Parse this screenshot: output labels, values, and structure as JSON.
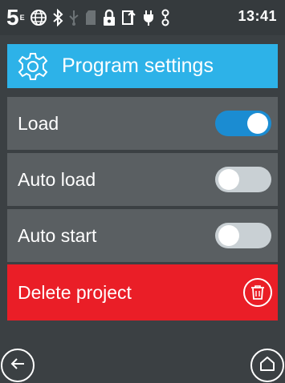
{
  "status_bar": {
    "icons": [
      "five-icon",
      "globe-icon",
      "bluetooth-icon",
      "usb-icon",
      "sd-card-icon",
      "lock-icon",
      "sync-icon",
      "plug-icon",
      "battery-icon"
    ],
    "time": "13:41"
  },
  "header": {
    "icon": "gear-icon",
    "title": "Program settings"
  },
  "settings": [
    {
      "label": "Load",
      "state": "on"
    },
    {
      "label": "Auto load",
      "state": "off"
    },
    {
      "label": "Auto start",
      "state": "off"
    }
  ],
  "delete": {
    "label": "Delete project",
    "icon": "trash-icon"
  },
  "nav": {
    "back_icon": "back-arrow-icon",
    "home_icon": "home-icon"
  },
  "colors": {
    "background": "#3b4043",
    "row": "#5a5f62",
    "header": "#2db2e8",
    "toggle_on": "#1b8cd2",
    "toggle_off": "#c9d0d4",
    "delete": "#ea1e27"
  }
}
